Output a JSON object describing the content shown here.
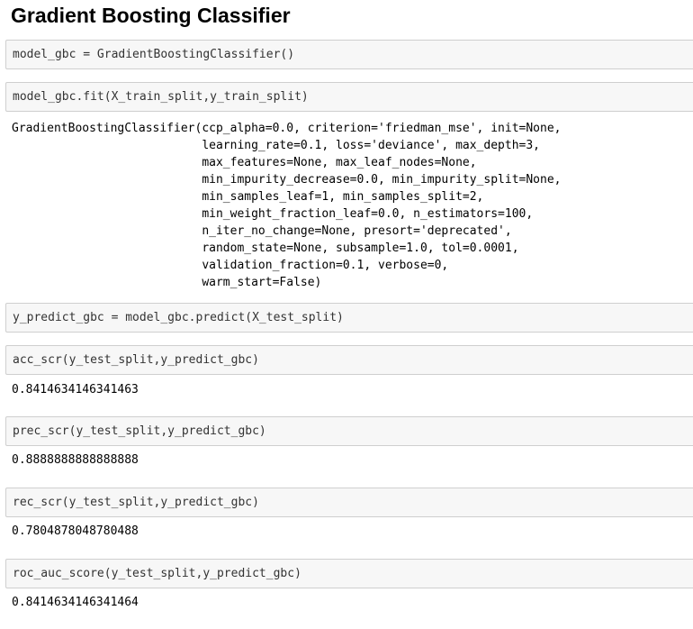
{
  "heading": "Gradient Boosting Classifier",
  "cells": [
    {
      "code": "model_gbc = GradientBoostingClassifier()",
      "output": []
    },
    {
      "code": "model_gbc.fit(X_train_split,y_train_split)",
      "output": [
        "GradientBoostingClassifier(ccp_alpha=0.0, criterion='friedman_mse', init=None,",
        "                           learning_rate=0.1, loss='deviance', max_depth=3,",
        "                           max_features=None, max_leaf_nodes=None,",
        "                           min_impurity_decrease=0.0, min_impurity_split=None,",
        "                           min_samples_leaf=1, min_samples_split=2,",
        "                           min_weight_fraction_leaf=0.0, n_estimators=100,",
        "                           n_iter_no_change=None, presort='deprecated',",
        "                           random_state=None, subsample=1.0, tol=0.0001,",
        "                           validation_fraction=0.1, verbose=0,",
        "                           warm_start=False)"
      ]
    },
    {
      "code": "y_predict_gbc = model_gbc.predict(X_test_split)",
      "output": []
    },
    {
      "code": "acc_scr(y_test_split,y_predict_gbc)",
      "output": [
        "0.8414634146341463"
      ]
    },
    {
      "code": "prec_scr(y_test_split,y_predict_gbc)",
      "output": [
        "0.8888888888888888"
      ]
    },
    {
      "code": "rec_scr(y_test_split,y_predict_gbc)",
      "output": [
        "0.7804878048780488"
      ]
    },
    {
      "code": "roc_auc_score(y_test_split,y_predict_gbc)",
      "output": [
        "0.8414634146341464"
      ]
    }
  ]
}
